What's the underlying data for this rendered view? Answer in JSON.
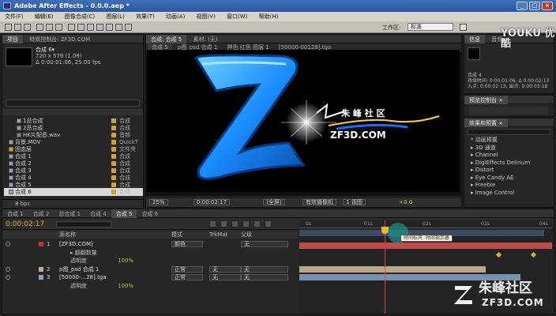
{
  "window": {
    "title": "Adobe After Effects - 0.0.0.aep *",
    "controls": [
      "_",
      "□",
      "×"
    ]
  },
  "menu": [
    "文件(F)",
    "编辑(E)",
    "图像合成(C)",
    "图层(L)",
    "效果(T)",
    "动画(A)",
    "视图(V)",
    "窗口(W)",
    "帮助(H)"
  ],
  "workspace": {
    "label": "工作区:",
    "value": "标准"
  },
  "project_panel": {
    "tabs": [
      "项目",
      "特效控制台: ZF3D.COM"
    ],
    "item_name": "合成 6▾",
    "item_details": [
      "720 x 576 (1.09)",
      "Δ 0:00:01:06, 25.00 fps"
    ],
    "search_placeholder": "",
    "rows": [
      {
        "name": "1总合成",
        "indent": 1,
        "icon": "comp",
        "type": "合成"
      },
      {
        "name": "2总合成",
        "indent": 1,
        "icon": "comp",
        "type": "合成"
      },
      {
        "name": "HK片配音.wav",
        "indent": 1,
        "icon": "audio",
        "type": "音频"
      },
      {
        "name": "背景.MOV",
        "indent": 0,
        "icon": "footage",
        "type": "QuickT"
      },
      {
        "name": "固态层",
        "indent": 0,
        "icon": "folder",
        "type": "文件夹"
      },
      {
        "name": "合成 1",
        "indent": 0,
        "icon": "comp",
        "type": "合成"
      },
      {
        "name": "合成 2",
        "indent": 0,
        "icon": "comp",
        "type": "合成"
      },
      {
        "name": "合成 3",
        "indent": 0,
        "icon": "comp",
        "type": "合成"
      },
      {
        "name": "合成 4",
        "indent": 0,
        "icon": "comp",
        "type": "合成"
      },
      {
        "name": "合成 5",
        "indent": 0,
        "icon": "comp",
        "type": "合成"
      },
      {
        "name": "合成 6",
        "indent": 0,
        "icon": "comp",
        "type": "合成",
        "selected": true
      }
    ],
    "footer_bpc": "8 bpc"
  },
  "comp_viewer": {
    "tabs": [
      "合成: 合成 5",
      "素材: (无)"
    ],
    "subtabs": [
      "合成 5",
      "p图_psd 合成 1",
      "押色 红色 图层 1",
      "[50000-00128].tga"
    ],
    "logo_letter": "Z",
    "logo_text_cn": "朱 峰 社 区",
    "logo_text_en": "ZF3D.COM",
    "controls": {
      "zoom": "25%",
      "timecode": "0:00:02:17",
      "resolution": "(全屏)",
      "camera": "有效摄像机",
      "views": "1 视图",
      "exposure": "+0.0"
    }
  },
  "info_panel": {
    "tabs": [
      "信息",
      "音频"
    ],
    "lines": [
      "合成 4",
      "持续时间: 0:00:01:06, Δ 0:00:02:13",
      "入点: 0:00:02:13, 出点: 0:00:03:18"
    ]
  },
  "preview_panel": {
    "title": "预览控制台 ×"
  },
  "effects_panel": {
    "title": "效果和预置 ×",
    "items": [
      "* 动画预置",
      "▸ 3D 通道",
      "▸ Channel",
      "▸ DigiEffects Delirium",
      "▸ Distort",
      "▸ Eye Candy AE",
      "▸ Freebie",
      "▸ Image Control"
    ]
  },
  "timeline": {
    "tabs": [
      "合成 1",
      "合成 2",
      "总合成 1",
      "合成 4",
      "合成 5",
      "合成 6"
    ],
    "active_tab": "合成 5",
    "timecode": "0:00:02:17",
    "columns": [
      "源名称",
      "模式",
      "TrkMat",
      "父级"
    ],
    "layers": [
      {
        "num": "1",
        "name": "[ZF3D.COM]",
        "mode": "颜色",
        "trk": "",
        "parent": "无",
        "color": "#cc3333"
      },
      {
        "num": "",
        "name": "▸ 翻翻数量",
        "mode": "",
        "trk": "",
        "parent": "",
        "color": ""
      },
      {
        "num": "",
        "name": "透明度",
        "value": "100%",
        "mode": "",
        "trk": "",
        "parent": "",
        "color": ""
      },
      {
        "num": "2",
        "name": "p图_psd 合成 1",
        "mode": "正常",
        "trk": "无",
        "parent": "无",
        "color": "#c0b090"
      },
      {
        "num": "3",
        "name": "[50000-...28].tga",
        "mode": "正常",
        "trk": "无",
        "parent": "无",
        "color": "#8aa0c0"
      },
      {
        "num": "",
        "name": "透明度",
        "value": "100%",
        "mode": "",
        "trk": "",
        "parent": "",
        "color": ""
      }
    ],
    "tooltip": "时间标尺: 时间指示器",
    "ruler_ticks": [
      "0s",
      "01s",
      "02s",
      "03s",
      "04s"
    ]
  },
  "watermarks": {
    "youku": "YOUKU 优酷",
    "site_cn": "朱峰社区",
    "site_en": "ZF3D.COM"
  },
  "colors": {
    "accent": "#1a8cff",
    "title_bar": "#2a56a0",
    "layer_red": "#cc3333"
  }
}
